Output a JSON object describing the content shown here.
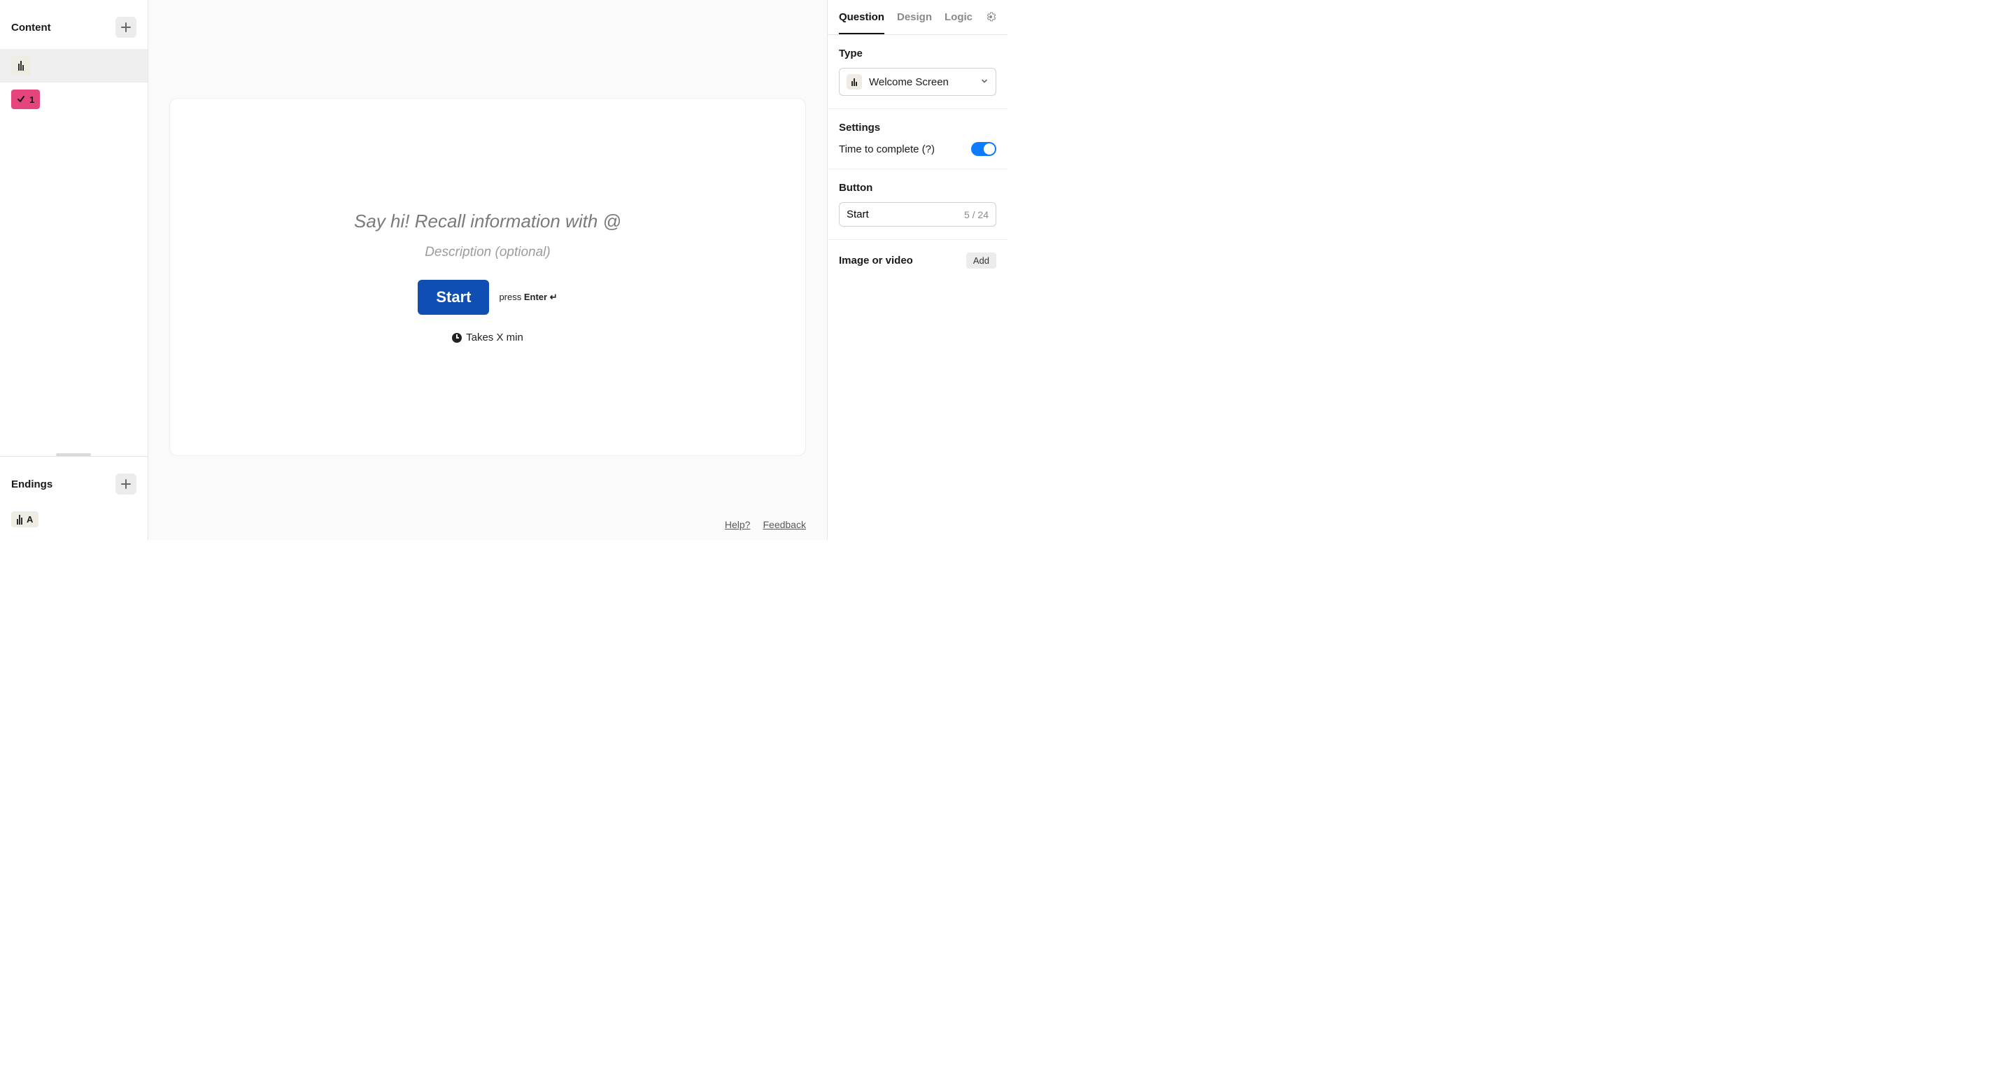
{
  "sidebar": {
    "content_title": "Content",
    "endings_title": "Endings",
    "question_badge_number": "1",
    "ending_letter": "A"
  },
  "canvas": {
    "title_placeholder": "Say hi! Recall information with @",
    "description_placeholder": "Description (optional)",
    "start_button": "Start",
    "press_prefix": "press ",
    "press_key": "Enter",
    "time_text": "Takes X min",
    "help_link": "Help?",
    "feedback_link": "Feedback"
  },
  "right": {
    "tabs": {
      "question": "Question",
      "design": "Design",
      "logic": "Logic"
    },
    "type_label": "Type",
    "type_value": "Welcome Screen",
    "settings_label": "Settings",
    "time_to_complete": "Time to complete (?)",
    "button_label": "Button",
    "button_value": "Start",
    "char_count": "5 / 24",
    "media_label": "Image or video",
    "add_label": "Add"
  }
}
